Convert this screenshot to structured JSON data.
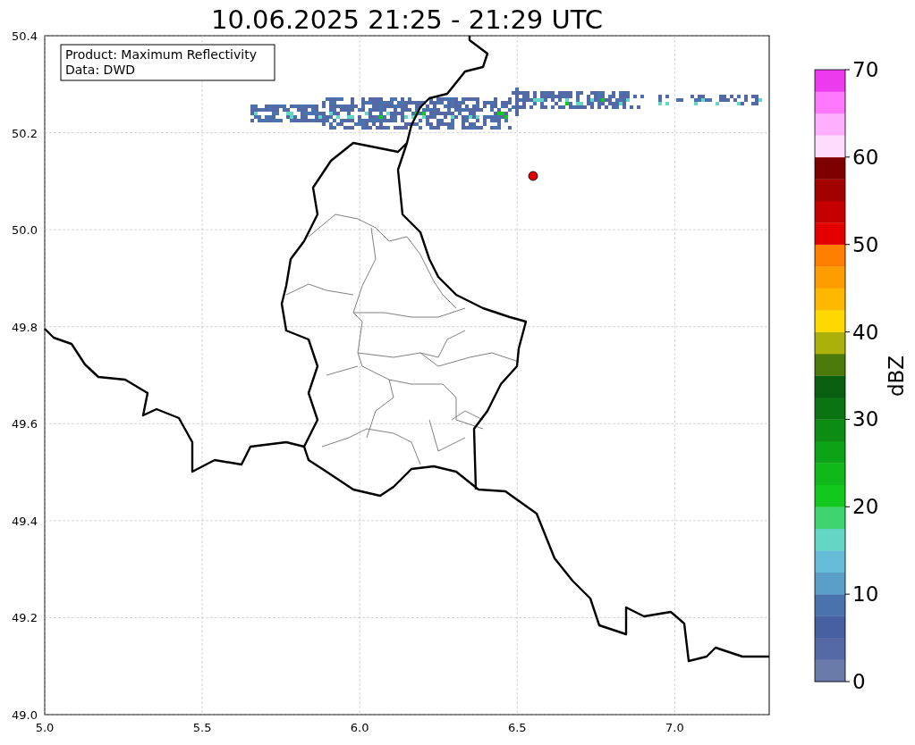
{
  "title": "10.06.2025 21:25 - 21:29 UTC",
  "legend": {
    "lines": [
      "Product: Maximum Reflectivity",
      "Data: DWD"
    ]
  },
  "map": {
    "xticks": [
      "5.0",
      "5.5",
      "6.0",
      "6.5",
      "7.0"
    ],
    "yticks": [
      "50.4",
      "50.2",
      "50.0",
      "49.8",
      "49.6",
      "49.4",
      "49.2",
      "49.0"
    ]
  },
  "colorbar": {
    "label": "dBZ",
    "ticks": [
      "70",
      "60",
      "50",
      "40",
      "30",
      "20",
      "10",
      "0"
    ],
    "segments": [
      {
        "color": "#6a7bab"
      },
      {
        "color": "#5468a6"
      },
      {
        "color": "#4660a2"
      },
      {
        "color": "#4a73ae"
      },
      {
        "color": "#5b9ec8"
      },
      {
        "color": "#64bcd9"
      },
      {
        "color": "#63d6c6"
      },
      {
        "color": "#3fd36f"
      },
      {
        "color": "#13c81c"
      },
      {
        "color": "#11b81a"
      },
      {
        "color": "#0da316"
      },
      {
        "color": "#0c8c13"
      },
      {
        "color": "#0b7412"
      },
      {
        "color": "#0a5e10"
      },
      {
        "color": "#4b7a0b"
      },
      {
        "color": "#acb00a"
      },
      {
        "color": "#fed800"
      },
      {
        "color": "#feb800"
      },
      {
        "color": "#fe9d00"
      },
      {
        "color": "#fe7f00"
      },
      {
        "color": "#e40000"
      },
      {
        "color": "#c40000"
      },
      {
        "color": "#a30000"
      },
      {
        "color": "#7f0000"
      },
      {
        "color": "#fedcfe"
      },
      {
        "color": "#feb0fe"
      },
      {
        "color": "#fe78fe"
      },
      {
        "color": "#ee3aee"
      }
    ]
  }
}
